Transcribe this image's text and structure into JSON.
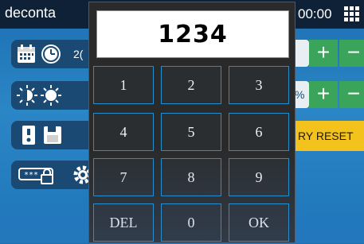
{
  "header": {
    "brand": "deconta",
    "time": "00:00"
  },
  "background_rows": {
    "row1_fragment": "2(",
    "row2_fragment": "%",
    "factory_reset_label": "RY RESET",
    "plus": "+",
    "minus": "−"
  },
  "keypad": {
    "display_value": "1234",
    "keys": [
      "1",
      "2",
      "3",
      "4",
      "5",
      "6",
      "7",
      "8",
      "9",
      "DEL",
      "0",
      "OK"
    ]
  },
  "colors": {
    "topbar": "#0e2136",
    "background": "#2b86c6",
    "keypad_bg": "#2a2a2a",
    "key_border": "#1f8fd0",
    "factory_reset": "#f4c21d",
    "plus_minus": "#3aa55a"
  }
}
